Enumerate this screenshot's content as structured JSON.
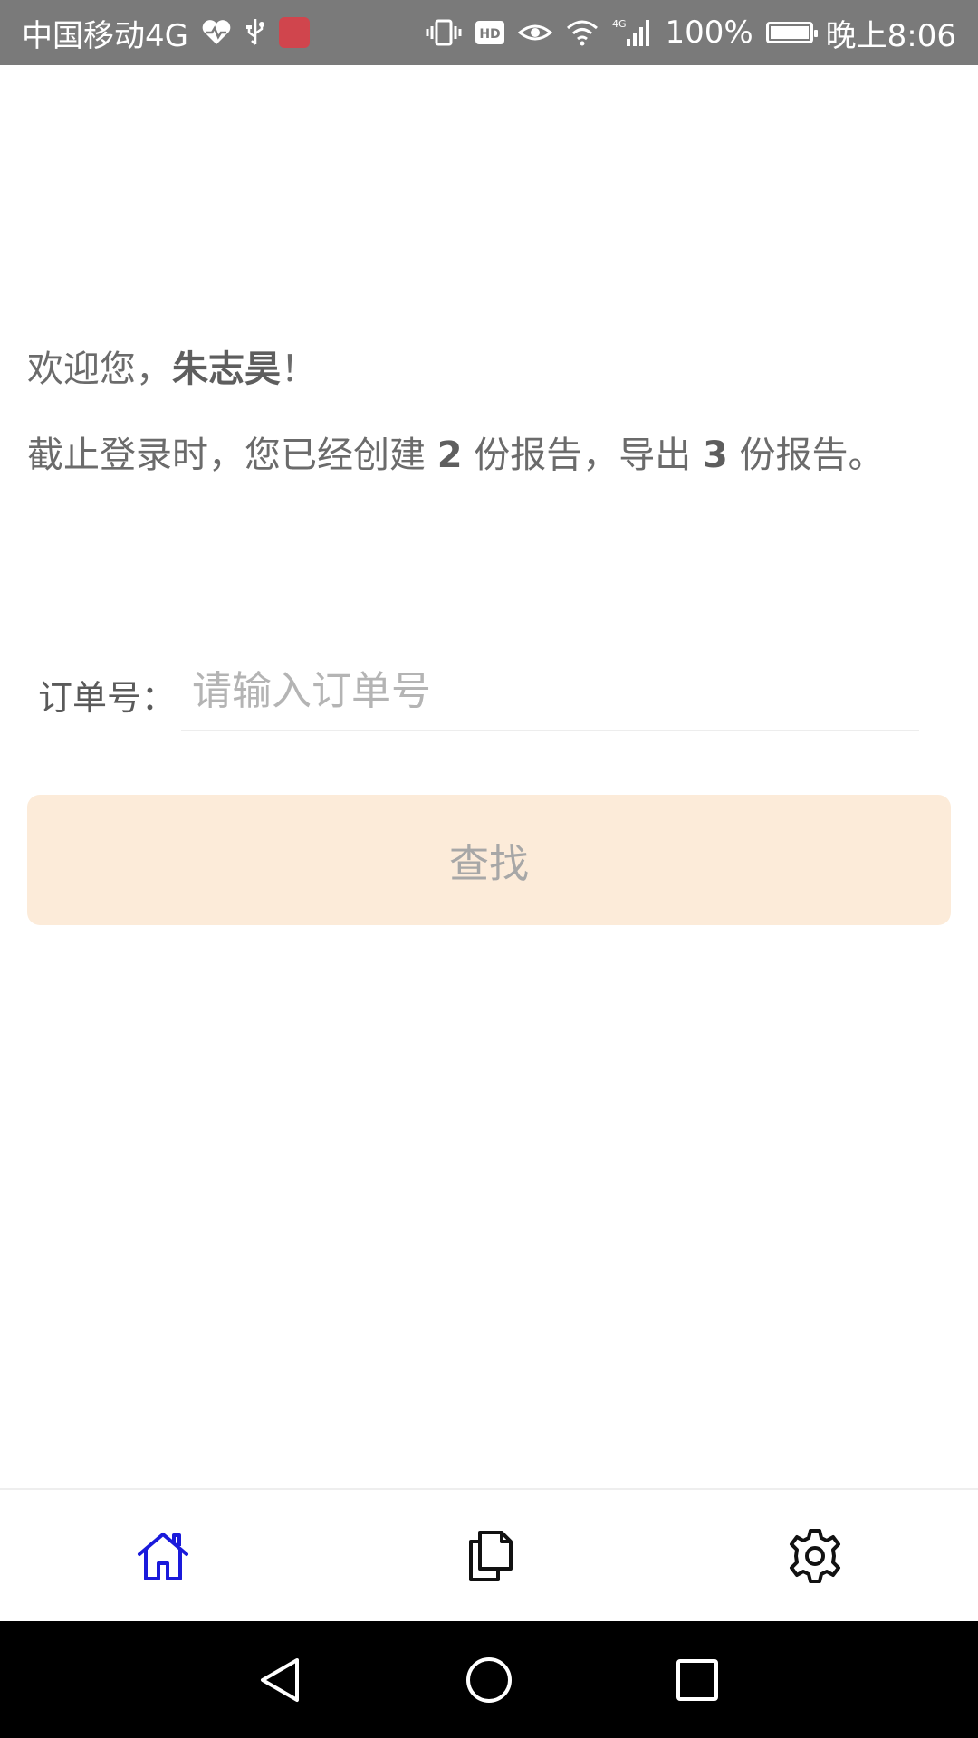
{
  "status_bar": {
    "carrier": "中国移动4G",
    "battery_percent": "100%",
    "time": "晚上8:06",
    "icons": [
      "heartbeat-icon",
      "usb-icon",
      "app-notification-icon",
      "vibrate-icon",
      "hd-icon",
      "eye-icon",
      "wifi-icon",
      "signal-4g-icon",
      "battery-icon"
    ]
  },
  "welcome": {
    "prefix": "欢迎您，",
    "user_name": "朱志昊",
    "suffix": "！"
  },
  "summary": {
    "text1": "截止登录时，您已经创建 ",
    "created_count": "2",
    "text2": " 份报告，导出 ",
    "exported_count": "3",
    "text3": " 份报告。"
  },
  "order": {
    "label": "订单号：",
    "placeholder": "请输入订单号",
    "value": ""
  },
  "search_button": {
    "label": "查找"
  },
  "bottom_nav": {
    "items": [
      {
        "icon": "home-icon",
        "active": true
      },
      {
        "icon": "documents-icon",
        "active": false
      },
      {
        "icon": "settings-icon",
        "active": false
      }
    ],
    "active_color": "#1a1adb",
    "inactive_color": "#111111"
  },
  "system_nav": {
    "icons": [
      "back-icon",
      "home-circle-icon",
      "recents-icon"
    ]
  },
  "colors": {
    "status_bar_bg": "#7a7a7a",
    "button_bg": "#fcebd9",
    "button_text": "#a7a7a7"
  }
}
